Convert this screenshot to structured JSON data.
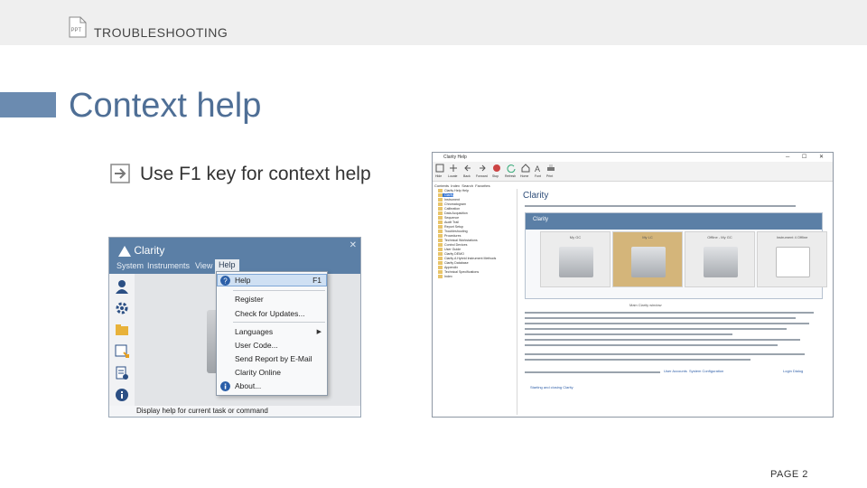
{
  "header": {
    "section": "TROUBLESHOOTING",
    "icon": "ppt-file-icon"
  },
  "slide": {
    "title": "Context help",
    "bullet": "Use F1 key for context help",
    "page": "PAGE 2"
  },
  "clarity": {
    "app_name": "Clarity",
    "menu": [
      "System",
      "Instruments",
      "View",
      "Help"
    ],
    "help_menu": {
      "items": [
        {
          "label": "Help",
          "shortcut": "F1"
        },
        {
          "label": "Register"
        },
        {
          "label": "Check for Updates..."
        },
        {
          "label": "Languages"
        },
        {
          "label": "User Code..."
        },
        {
          "label": "Send Report by E-Mail"
        },
        {
          "label": "Clarity Online"
        },
        {
          "label": "About..."
        }
      ]
    },
    "status": "Display help for current task or command"
  },
  "help_window": {
    "title": "Clarity Help",
    "toolbar": [
      "Hide",
      "Locate",
      "Back",
      "Forward",
      "Stop",
      "Refresh",
      "Home",
      "Font",
      "Print"
    ],
    "tabs": [
      "Contents",
      "Index",
      "Search",
      "Favorites"
    ],
    "tree": [
      "Clarity Help Help",
      "Clarity",
      "Instrument",
      "Chromatogram",
      "Calibration",
      "Data Acquisition",
      "Sequence",
      "Audit Trail",
      "Report Setup",
      "Troubleshooting",
      "Procedures",
      "Technical Workstations",
      "Control Devices",
      "User Guide",
      "Clarity DEMO",
      "Clarity A Hybrid Instrument Methods",
      "Clarity Database",
      "Appendix",
      "Technical Specifications",
      "Index"
    ],
    "content_title": "Clarity",
    "cards": [
      "My GC",
      "My LC",
      "Offline - My GC",
      "Instrument 4 Offline"
    ],
    "caption": "Main Clarity window",
    "link1": "User Accounts",
    "link2": "System Configuration",
    "link3": "Login Dialog",
    "bottom_link": "Starting and closing Clarity"
  },
  "colors": {
    "accent": "#6b8bb0",
    "title": "#4f6f96",
    "clarity_blue": "#5b7fa6"
  }
}
